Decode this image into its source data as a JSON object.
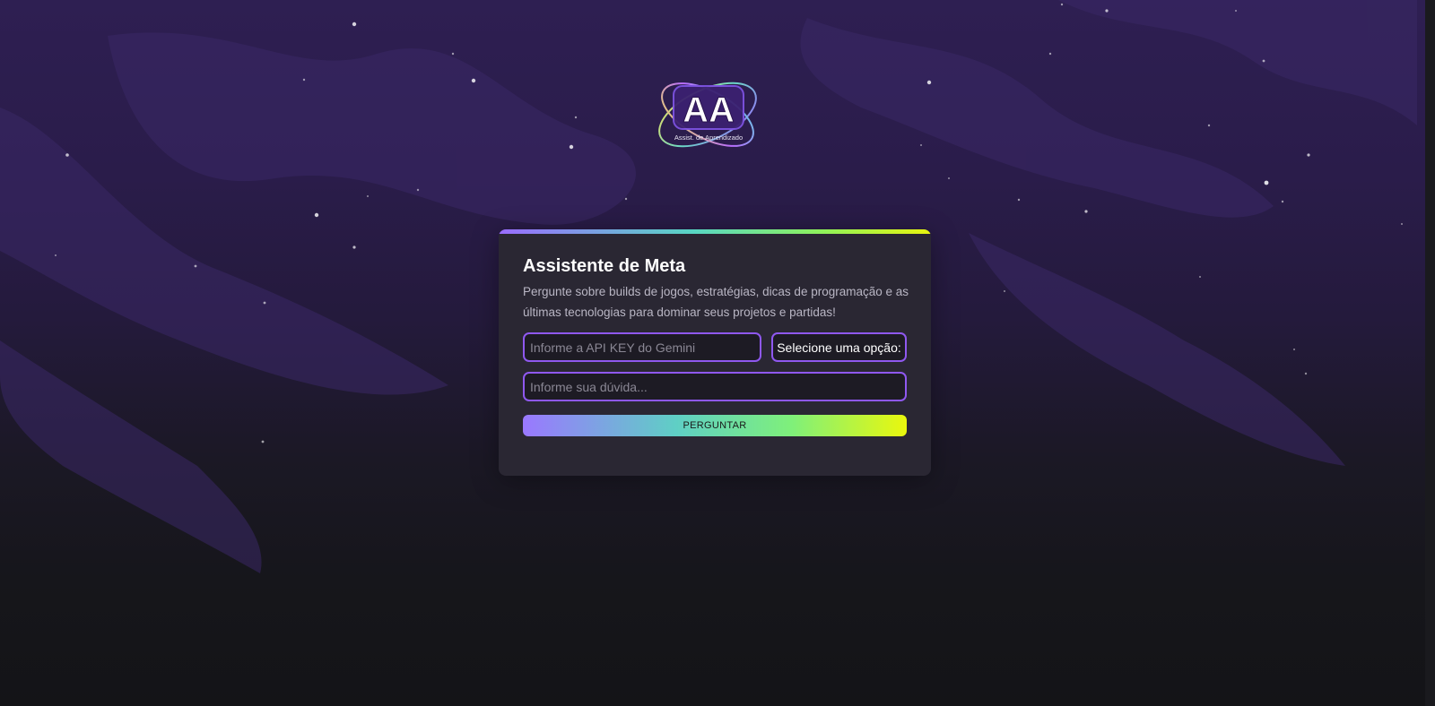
{
  "logo": {
    "letters": "AA",
    "tagline": "Assist. de Aprendizado"
  },
  "card": {
    "title": "Assistente de Meta",
    "description": "Pergunte sobre builds de jogos, estratégias, dicas de programação e as últimas tecnologias para dominar seus projetos e partidas!"
  },
  "form": {
    "api_key_placeholder": "Informe a API KEY do Gemini",
    "api_key_value": "",
    "select_label": "Selecione uma opção:",
    "question_placeholder": "Informe sua dúvida...",
    "question_value": "",
    "submit_label": "PERGUNTAR"
  },
  "colors": {
    "accent_purple": "#8f58f0",
    "gradient_start": "#9a78ff",
    "gradient_mid": "#5fcfc5",
    "gradient_end": "#eaf70d",
    "card_background": "#2a2733"
  }
}
